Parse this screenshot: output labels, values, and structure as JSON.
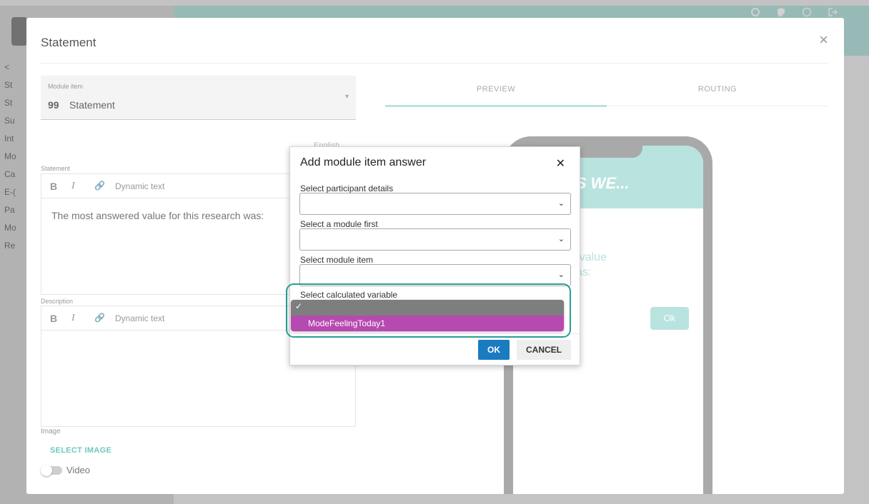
{
  "background": {
    "sidebar_items": [
      "<",
      "St",
      "St",
      "Su",
      "Int",
      "Mo",
      "Ca",
      "E-(",
      "Pa",
      "Mo",
      "Re"
    ],
    "top_icons": [
      "gear-icon",
      "shield-icon",
      "help-icon",
      "logout-icon"
    ]
  },
  "modal": {
    "title": "Statement",
    "close_symbol": "×",
    "module_item": {
      "label": "Module item",
      "quote_symbol": "99",
      "value": "Statement",
      "caret": "▾"
    },
    "tabs": {
      "preview": "PREVIEW",
      "routing": "ROUTING"
    },
    "language": "English",
    "statement_editor": {
      "label": "Statement",
      "bold": "B",
      "italic": "I",
      "link_symbol": "🔗",
      "dynamic_text": "Dynamic text",
      "content": "The most answered value for this research was:"
    },
    "description_editor": {
      "label": "Description",
      "bold": "B",
      "italic": "I",
      "link_symbol": "🔗",
      "dynamic_text": "Dynamic text",
      "content": ""
    },
    "image_label": "Image",
    "select_image": "SELECT IMAGE",
    "video_label": "Video"
  },
  "phone_preview": {
    "header_text": "DENTS WE...",
    "body_line1": "t answered value",
    "body_line2": "research was:",
    "ok_label": "Ok"
  },
  "answer_dialog": {
    "title": "Add module item answer",
    "close_symbol": "✕",
    "chevron": "⌄",
    "participant_label": "Select participant details",
    "module_label": "Select a module first",
    "module_item_label": "Select module item",
    "calculated_label": "Select calculated variable",
    "dropdown": {
      "blank_check": "✓",
      "option": "ModeFeelingToday1"
    },
    "ok_label": "OK",
    "cancel_label": "CANCEL"
  },
  "colors": {
    "accent": "#b9e3df",
    "primary_button": "#1a7bc0",
    "selected_option": "#b64ab0",
    "highlight_ring": "#2a9d94"
  }
}
